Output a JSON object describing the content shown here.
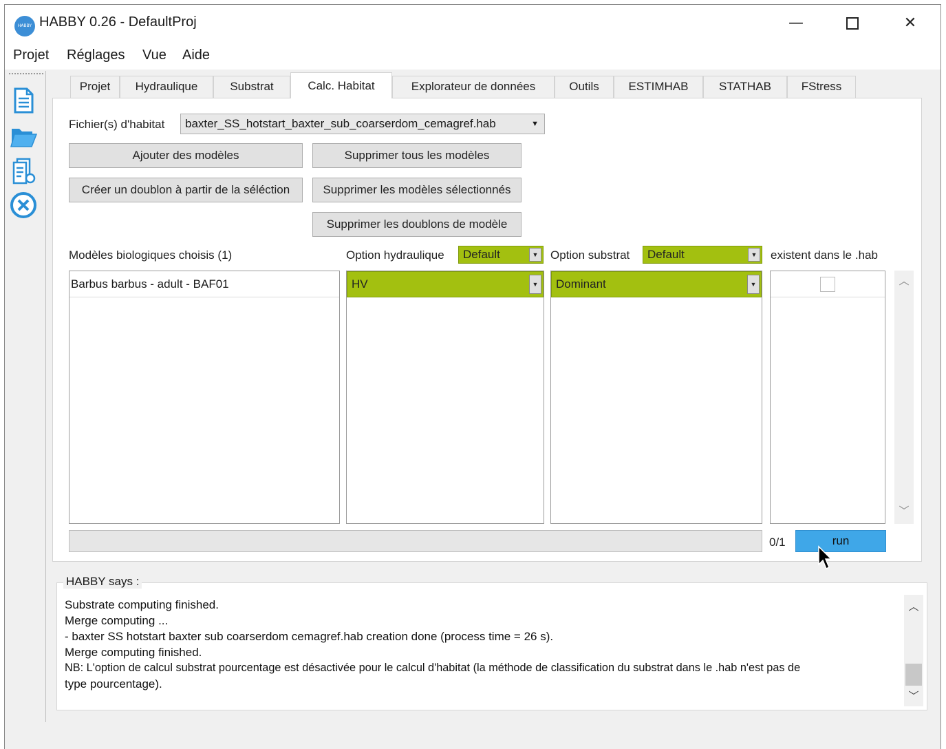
{
  "window": {
    "title": "HABBY 0.26 - DefaultProj",
    "logo_text": "HABBY",
    "controls": {
      "minimize": "—",
      "close": "✕"
    }
  },
  "menu": [
    "Projet",
    "Réglages",
    "Vue",
    "Aide"
  ],
  "toolbar_icons": [
    "new-project-icon",
    "open-folder-icon",
    "report-icon",
    "close-project-icon"
  ],
  "tabs": [
    {
      "label": "Projet"
    },
    {
      "label": "Hydraulique"
    },
    {
      "label": "Substrat"
    },
    {
      "label": "Calc. Habitat",
      "active": true
    },
    {
      "label": "Explorateur de données"
    },
    {
      "label": "Outils"
    },
    {
      "label": "ESTIMHAB"
    },
    {
      "label": "STATHAB"
    },
    {
      "label": "FStress"
    }
  ],
  "habitat": {
    "file_label": "Fichier(s) d'habitat",
    "file_value": "baxter_SS_hotstart_baxter_sub_coarserdom_cemagref.hab",
    "buttons": {
      "add_models": "Ajouter des modèles",
      "delete_all": "Supprimer tous les modèles",
      "duplicate": "Créer un doublon à partir de la séléction",
      "delete_selected": "Supprimer les modèles sélectionnés",
      "delete_duplicates": "Supprimer les doublons de modèle"
    },
    "models_label": "Modèles biologiques choisis (1)",
    "hydraulic_label": "Option hydraulique",
    "hydraulic_default": "Default",
    "substrate_label": "Option substrat",
    "substrate_default": "Default",
    "exists_label": "existent dans le .hab",
    "models": [
      {
        "name": "Barbus barbus - adult - BAF01",
        "hydraulic": "HV",
        "substrate": "Dominant",
        "exists": false
      }
    ],
    "progress_text": "0/1",
    "progress_fraction": 0,
    "run_label": "run"
  },
  "log": {
    "title": "HABBY says :",
    "lines": [
      "Substrate computing finished.",
      "Merge computing ...",
      "- baxter SS hotstart baxter sub coarserdom cemagref.hab creation done (process time = 26 s).",
      "Merge computing finished.",
      "NB: L'option de calcul substrat pourcentage est désactivée pour le calcul d'habitat (la méthode de classification du substrat dans le .hab n'est pas de",
      "type pourcentage)."
    ]
  },
  "colors": {
    "accent_green": "#a3c010",
    "run_blue": "#3fa7e8",
    "icon_blue": "#2a8fd6"
  }
}
